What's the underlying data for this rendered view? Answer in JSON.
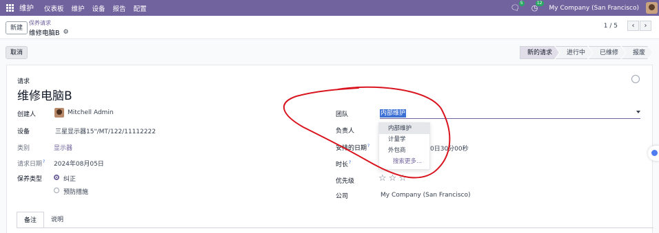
{
  "navbar": {
    "brand": "维护",
    "menu": [
      "仪表板",
      "维护",
      "设备",
      "报告",
      "配置"
    ],
    "chat_badge": "5",
    "activity_badge": "12",
    "company": "My Company (San Francisco)"
  },
  "control": {
    "new_label": "新建",
    "breadcrumb_parent": "保养请求",
    "breadcrumb_current": "维修电脑B",
    "pager": "1 / 5"
  },
  "statusbar": {
    "cancel_label": "取消",
    "stages": [
      "新的请求",
      "进行中",
      "已维修",
      "报废"
    ]
  },
  "form": {
    "request_label": "请求",
    "title": "维修电脑B",
    "created_by_label": "创建人",
    "created_by": "Mitchell Admin",
    "equipment_label": "设备",
    "equipment": "三星显示器15\"/MT/122/11112222",
    "category_label": "类别",
    "category": "显示器",
    "request_date_label": "请求日期",
    "request_date": "2024年08月05日",
    "maintenance_type_label": "保养类型",
    "type_corrective": "纠正",
    "type_preventive": "预防措施",
    "team_label": "团队",
    "team_value": "内部维护",
    "responsible_label": "负责人",
    "scheduled_label": "安排的日期",
    "scheduled_value_partial": "0日30分00秒",
    "duration_label": "时长",
    "priority_label": "优先级",
    "company_label": "公司",
    "company": "My Company (San Francisco)",
    "dropdown": [
      "内部维护",
      "计量学",
      "外包商"
    ],
    "search_more": "搜索更多..."
  },
  "tabs": [
    "备注",
    "说明"
  ]
}
